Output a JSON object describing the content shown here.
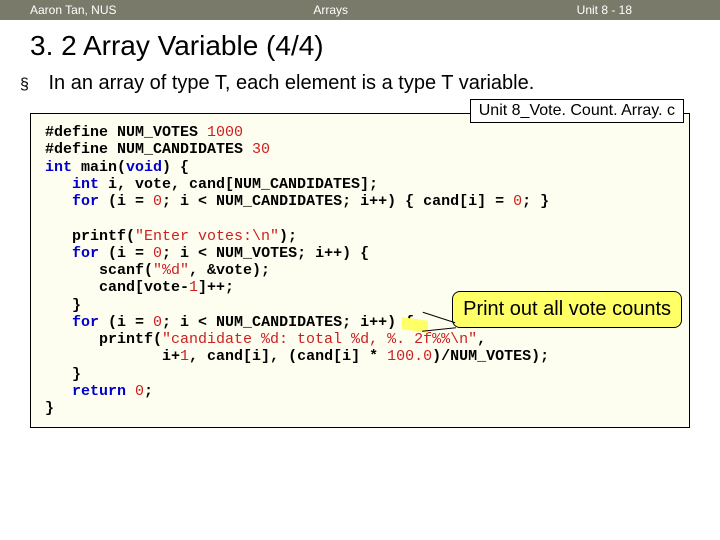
{
  "topbar": {
    "left": "Aaron Tan, NUS",
    "mid": "Arrays",
    "right": "Unit 8 - 18"
  },
  "heading": "3. 2 Array Variable (4/4)",
  "bullet_text": "In an array of type T, each element is a type T variable.",
  "filename": "Unit 8_Vote. Count. Array. c",
  "callout": "Print out all vote counts",
  "code": {
    "l01a": "#define NUM_VOTES ",
    "l01n": "1000",
    "l02a": "#define NUM_CANDIDATES ",
    "l02n": "30",
    "l03a": "int ",
    "l03b": "main(",
    "l03c": "void",
    "l03d": ") {",
    "l04a": "   int ",
    "l04b": "i, vote, cand[NUM_CANDIDATES];",
    "l05a": "   for ",
    "l05b": "(i = ",
    "l05n1": "0",
    "l05c": "; i < NUM_CANDIDATES; i++) { cand[i] = ",
    "l05n2": "0",
    "l05d": "; }",
    "l07a": "   printf(",
    "l07s": "\"Enter votes:\\n\"",
    "l07b": ");",
    "l08a": "   for ",
    "l08b": "(i = ",
    "l08n": "0",
    "l08c": "; i < NUM_VOTES; i++) {",
    "l09a": "      scanf(",
    "l09s": "\"%d\"",
    "l09b": ", &vote);",
    "l10a": "      cand[vote-",
    "l10n": "1",
    "l10b": "]++;",
    "l11": "   }",
    "l12a": "   for ",
    "l12b": "(i = ",
    "l12n": "0",
    "l12c": "; i < NUM_CANDIDATES; i++) {",
    "l13a": "      printf(",
    "l13s": "\"candidate %d: total %d, %. 2f%%\\n\"",
    "l13b": ",",
    "l14a": "             i+",
    "l14n1": "1",
    "l14b": ", cand[i], (cand[i] * ",
    "l14n2": "100.0",
    "l14c": ")/NUM_VOTES);",
    "l15": "   }",
    "l16a": "   return ",
    "l16n": "0",
    "l16b": ";",
    "l17": "}"
  }
}
